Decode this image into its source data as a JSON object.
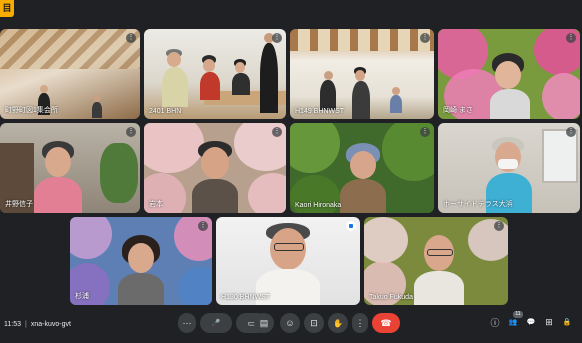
{
  "app": {
    "badge": "目",
    "meeting_code": "xna-kuvo-gvt",
    "time": "11:53"
  },
  "participants": [
    {
      "name": "町野町図1集会所"
    },
    {
      "name": "2401 BHN"
    },
    {
      "name": "H149 BHNWST"
    },
    {
      "name": "岡崎 まさ"
    },
    {
      "name": "井野信子"
    },
    {
      "name": "岩本"
    },
    {
      "name": "Kaori Hironaka"
    },
    {
      "name": "ホーサイドテラス大浜"
    },
    {
      "name": "杉浦"
    },
    {
      "name": "H130 BHNWST"
    },
    {
      "name": "Takuo Fukuda"
    }
  ],
  "tile_menu_glyph": "⋮",
  "controls": {
    "more_options": "⋯",
    "mic": "🎤",
    "mic_caret": "⌃",
    "camera": "▭",
    "camera_caret": "⌃",
    "captions": "▤",
    "emoji": "☺",
    "present": "⊡",
    "raise_hand": "✋",
    "more": "⋮",
    "leave": "☎"
  },
  "right_controls": {
    "info": "ⓘ",
    "people": "👥",
    "people_count": "11",
    "chat": "💬",
    "activities": "⊞",
    "host": "🔒"
  },
  "colors": {
    "leave": "#ea4335",
    "background": "#202124",
    "tile": "#3c4043"
  }
}
